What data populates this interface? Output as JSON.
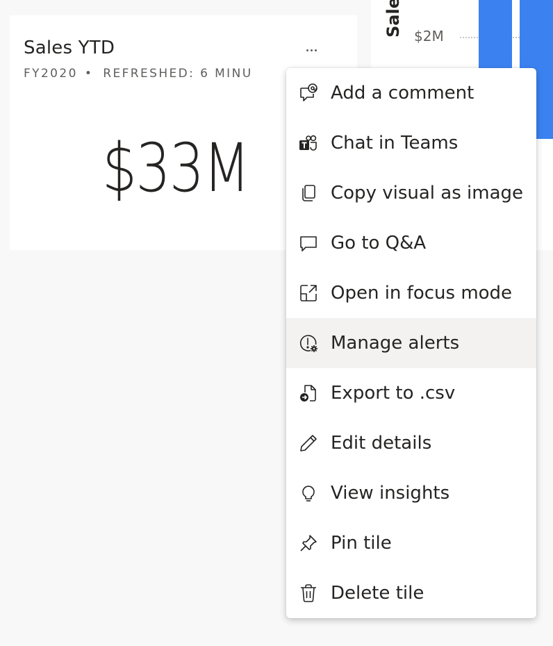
{
  "card": {
    "title": "Sales YTD",
    "subtitle_left": "FY2020",
    "subtitle_separator": "•",
    "subtitle_right": "REFRESHED: 6 MINU",
    "value": "$33M",
    "more_options_icon": "more-horizontal-icon"
  },
  "chart": {
    "ylabel": "Sale",
    "tick": "$2M",
    "bar_color": "#3b82f0"
  },
  "menu": {
    "items": [
      {
        "label": "Add a comment",
        "icon": "comment-icon"
      },
      {
        "label": "Chat in Teams",
        "icon": "teams-icon"
      },
      {
        "label": "Copy visual as image",
        "icon": "copy-icon"
      },
      {
        "label": "Go to Q&A",
        "icon": "chat-bubble-icon"
      },
      {
        "label": "Open in focus mode",
        "icon": "open-in-focus-icon"
      },
      {
        "label": "Manage alerts",
        "icon": "alert-settings-icon"
      },
      {
        "label": "Export to .csv",
        "icon": "export-file-icon"
      },
      {
        "label": "Edit details",
        "icon": "pencil-icon"
      },
      {
        "label": "View insights",
        "icon": "lightbulb-icon"
      },
      {
        "label": "Pin tile",
        "icon": "pin-icon"
      },
      {
        "label": "Delete tile",
        "icon": "trash-icon"
      }
    ],
    "hovered_label": "Manage alerts",
    "hover_color": "#f3f2f1"
  }
}
